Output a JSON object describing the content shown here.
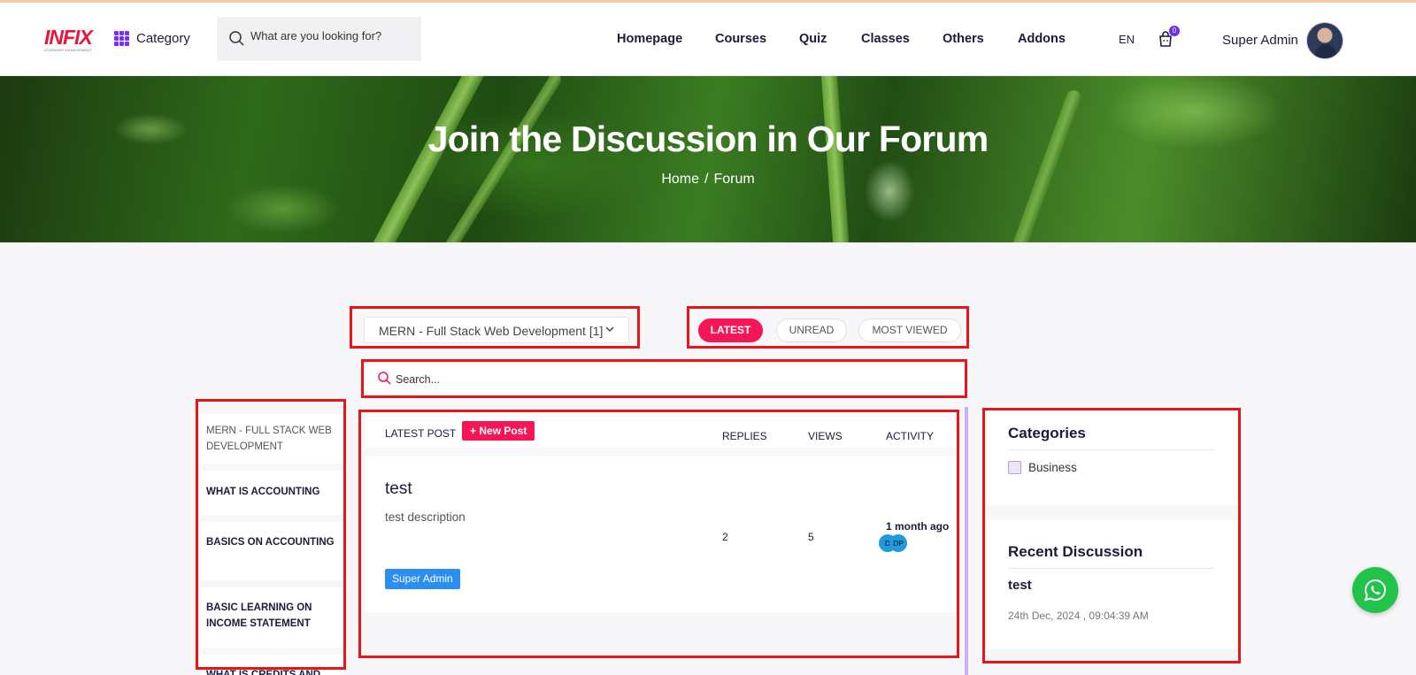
{
  "header": {
    "logo_text": "INFIX",
    "logo_subtitle": "LEARNING MANAGEMENT",
    "category_label": "Category",
    "search_placeholder": "What are you looking for?",
    "nav": [
      "Homepage",
      "Courses",
      "Quiz",
      "Classes",
      "Others",
      "Addons"
    ],
    "language": "EN",
    "cart_count": "0",
    "user_name": "Super Admin"
  },
  "hero": {
    "title": "Join the Discussion in Our Forum",
    "breadcrumb": [
      "Home",
      "/",
      "Forum"
    ]
  },
  "filters": {
    "course_selected": "MERN - Full Stack Web Development [1]",
    "tabs": [
      "LATEST",
      "UNREAD",
      "MOST VIEWED"
    ],
    "active_tab": "LATEST",
    "search_placeholder": "Search..."
  },
  "sidebar": {
    "items": [
      "MERN - FULL STACK WEB DEVELOPMENT",
      "WHAT IS ACCOUNTING",
      "BASICS ON ACCOUNTING",
      "BASIC LEARNING ON INCOME STATEMENT",
      "WHAT IS CREDITS AND"
    ]
  },
  "posts": {
    "header_label": "LATEST POST",
    "new_post_label": "New Post",
    "columns": [
      "REPLIES",
      "VIEWS",
      "ACTIVITY"
    ],
    "items": [
      {
        "title": "test",
        "description": "test description",
        "replies": "2",
        "views": "5",
        "activity": "1 month ago",
        "participants": [
          "D",
          "DP"
        ],
        "author": "Super Admin"
      }
    ]
  },
  "right_sidebar": {
    "categories_title": "Categories",
    "categories": [
      "Business"
    ],
    "recent_title": "Recent Discussion",
    "recent": [
      {
        "title": "test",
        "date": "24th Dec, 2024 , 09:04:39 AM"
      }
    ]
  },
  "colors": {
    "accent": "#f41656",
    "highlight_box": "#e8141c",
    "author_badge": "#2c8ef0",
    "whatsapp": "#22c34a"
  }
}
